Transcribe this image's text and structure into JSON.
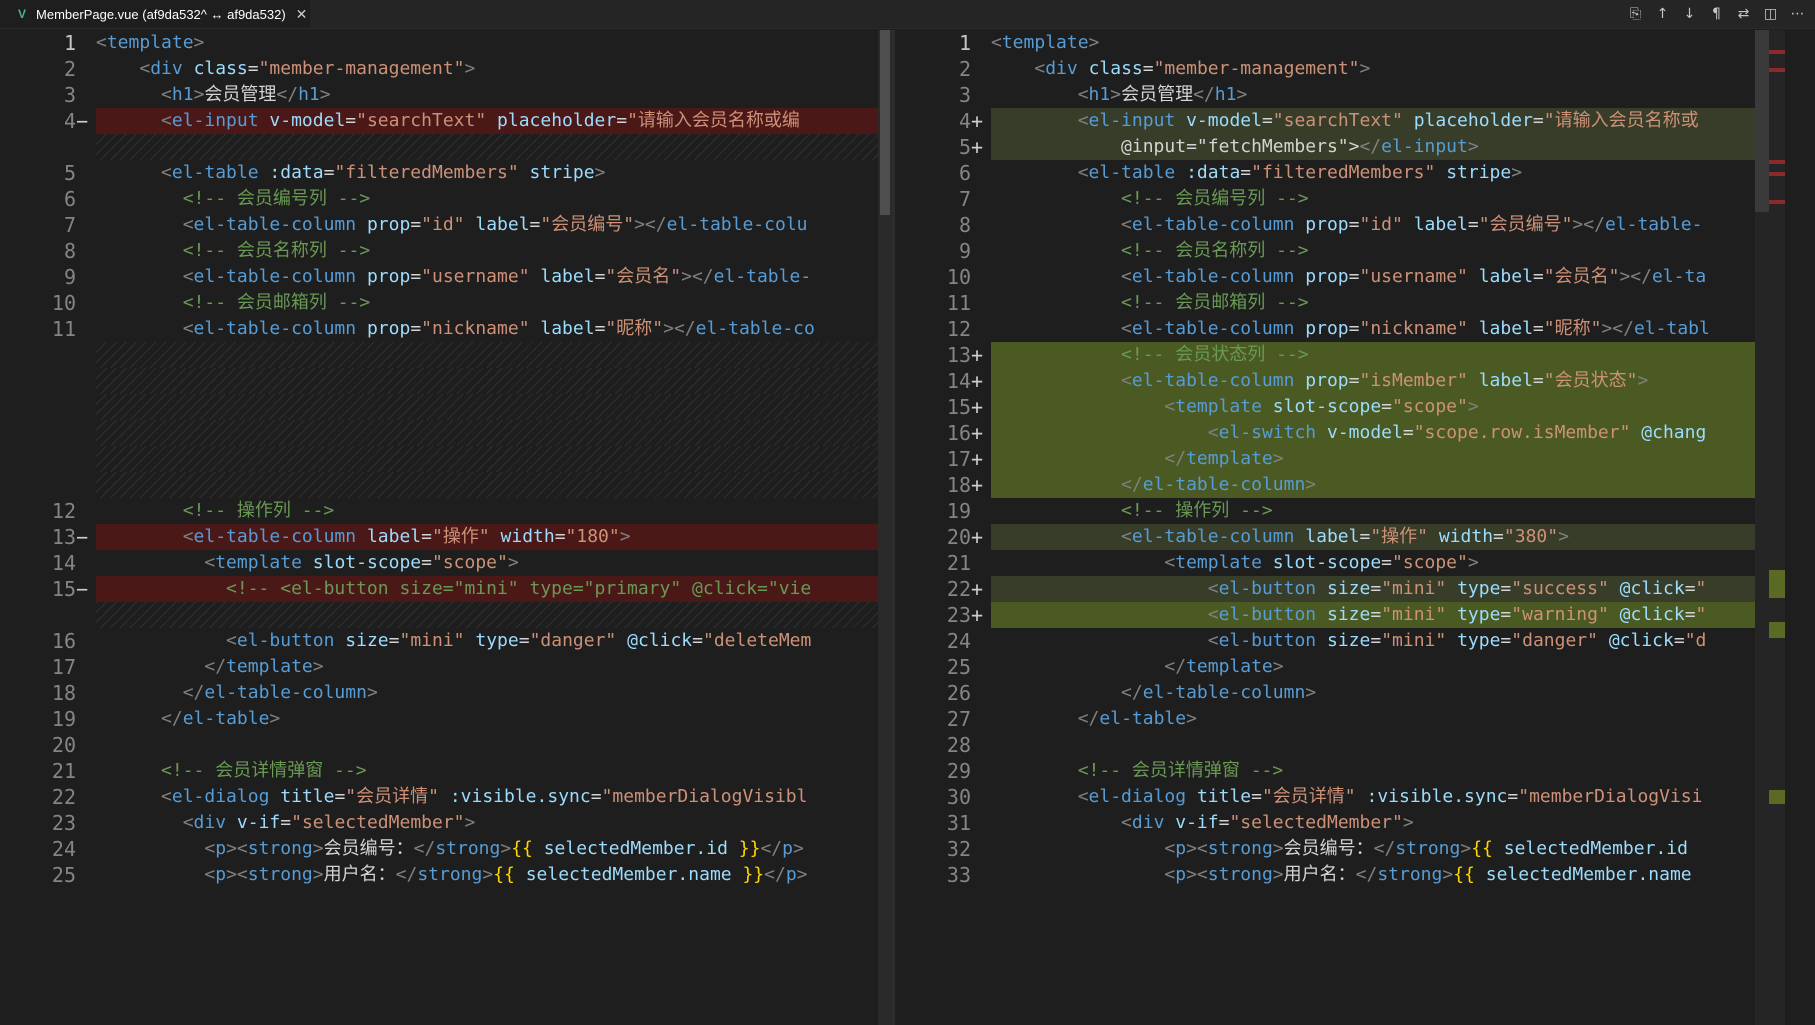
{
  "tab": {
    "title": "MemberPage.vue (af9da532^ ↔ af9da532)",
    "icon": "V",
    "close": "✕"
  },
  "toolbar": {
    "buttons": [
      {
        "name": "open-file-icon",
        "glyph": "⎘"
      },
      {
        "name": "previous-change-icon",
        "glyph": "↑"
      },
      {
        "name": "next-change-icon",
        "glyph": "↓"
      },
      {
        "name": "show-whitespace-icon",
        "glyph": "¶"
      },
      {
        "name": "compare-icon",
        "glyph": "⇄"
      },
      {
        "name": "split-editor-icon",
        "glyph": "◫"
      },
      {
        "name": "more-actions-icon",
        "glyph": "⋯"
      }
    ]
  },
  "colors": {
    "editor_bg": "#1e1e1e",
    "removed_bg": "#4b1818",
    "inserted_bg": "#4b5a22",
    "tag": "#569cd6",
    "attr": "#9cdcfe",
    "string": "#ce9178",
    "comment": "#6a9955"
  },
  "left": {
    "lines": [
      {
        "n": "1",
        "m": "",
        "t": "<template>",
        "kind": ""
      },
      {
        "n": "2",
        "m": "",
        "t": "    <div class=\"member-management\">",
        "kind": ""
      },
      {
        "n": "3",
        "m": "",
        "t": "      <h1>会员管理</h1>",
        "kind": ""
      },
      {
        "n": "4",
        "m": "−",
        "t": "      <el-input v-model=\"searchText\" placeholder=\"请输入会员名称或编",
        "kind": "del"
      },
      {
        "n": "",
        "m": "",
        "t": "",
        "kind": "hatch"
      },
      {
        "n": "5",
        "m": "",
        "t": "      <el-table :data=\"filteredMembers\" stripe>",
        "kind": ""
      },
      {
        "n": "6",
        "m": "",
        "t": "        <!-- 会员编号列 -->",
        "kind": ""
      },
      {
        "n": "7",
        "m": "",
        "t": "        <el-table-column prop=\"id\" label=\"会员编号\"></el-table-colu",
        "kind": ""
      },
      {
        "n": "8",
        "m": "",
        "t": "        <!-- 会员名称列 -->",
        "kind": ""
      },
      {
        "n": "9",
        "m": "",
        "t": "        <el-table-column prop=\"username\" label=\"会员名\"></el-table-",
        "kind": ""
      },
      {
        "n": "10",
        "m": "",
        "t": "        <!-- 会员邮箱列 -->",
        "kind": ""
      },
      {
        "n": "11",
        "m": "",
        "t": "        <el-table-column prop=\"nickname\" label=\"昵称\"></el-table-co",
        "kind": ""
      },
      {
        "n": "",
        "m": "",
        "t": "",
        "kind": "hatch"
      },
      {
        "n": "",
        "m": "",
        "t": "",
        "kind": "hatch"
      },
      {
        "n": "",
        "m": "",
        "t": "",
        "kind": "hatch"
      },
      {
        "n": "",
        "m": "",
        "t": "",
        "kind": "hatch"
      },
      {
        "n": "",
        "m": "",
        "t": "",
        "kind": "hatch"
      },
      {
        "n": "",
        "m": "",
        "t": "",
        "kind": "hatch"
      },
      {
        "n": "12",
        "m": "",
        "t": "        <!-- 操作列 -->",
        "kind": ""
      },
      {
        "n": "13",
        "m": "−",
        "t": "        <el-table-column label=\"操作\" width=\"180\">",
        "kind": "del"
      },
      {
        "n": "14",
        "m": "",
        "t": "          <template slot-scope=\"scope\">",
        "kind": ""
      },
      {
        "n": "15",
        "m": "−",
        "t": "            <!-- <el-button size=\"mini\" type=\"primary\" @click=\"vie",
        "kind": "del"
      },
      {
        "n": "",
        "m": "",
        "t": "",
        "kind": "hatch"
      },
      {
        "n": "16",
        "m": "",
        "t": "            <el-button size=\"mini\" type=\"danger\" @click=\"deleteMem",
        "kind": ""
      },
      {
        "n": "17",
        "m": "",
        "t": "          </template>",
        "kind": ""
      },
      {
        "n": "18",
        "m": "",
        "t": "        </el-table-column>",
        "kind": ""
      },
      {
        "n": "19",
        "m": "",
        "t": "      </el-table>",
        "kind": ""
      },
      {
        "n": "20",
        "m": "",
        "t": "",
        "kind": ""
      },
      {
        "n": "21",
        "m": "",
        "t": "      <!-- 会员详情弹窗 -->",
        "kind": ""
      },
      {
        "n": "22",
        "m": "",
        "t": "      <el-dialog title=\"会员详情\" :visible.sync=\"memberDialogVisibl",
        "kind": ""
      },
      {
        "n": "23",
        "m": "",
        "t": "        <div v-if=\"selectedMember\">",
        "kind": ""
      },
      {
        "n": "24",
        "m": "",
        "t": "          <p><strong>会员编号：</strong>{{ selectedMember.id }}</p>",
        "kind": ""
      },
      {
        "n": "25",
        "m": "",
        "t": "          <p><strong>用户名：</strong>{{ selectedMember.name }}</p>",
        "kind": ""
      }
    ]
  },
  "right": {
    "lines": [
      {
        "n": "1",
        "m": "",
        "t": "<template>",
        "kind": ""
      },
      {
        "n": "2",
        "m": "",
        "t": "    <div class=\"member-management\">",
        "kind": ""
      },
      {
        "n": "3",
        "m": "",
        "t": "        <h1>会员管理</h1>",
        "kind": ""
      },
      {
        "n": "4",
        "m": "+",
        "t": "        <el-input v-model=\"searchText\" placeholder=\"请输入会员名称或",
        "kind": "ins"
      },
      {
        "n": "5",
        "m": "+",
        "t": "            @input=\"fetchMembers\"></el-input>",
        "kind": "ins"
      },
      {
        "n": "6",
        "m": "",
        "t": "        <el-table :data=\"filteredMembers\" stripe>",
        "kind": ""
      },
      {
        "n": "7",
        "m": "",
        "t": "            <!-- 会员编号列 -->",
        "kind": ""
      },
      {
        "n": "8",
        "m": "",
        "t": "            <el-table-column prop=\"id\" label=\"会员编号\"></el-table-",
        "kind": ""
      },
      {
        "n": "9",
        "m": "",
        "t": "            <!-- 会员名称列 -->",
        "kind": ""
      },
      {
        "n": "10",
        "m": "",
        "t": "            <el-table-column prop=\"username\" label=\"会员名\"></el-ta",
        "kind": ""
      },
      {
        "n": "11",
        "m": "",
        "t": "            <!-- 会员邮箱列 -->",
        "kind": ""
      },
      {
        "n": "12",
        "m": "",
        "t": "            <el-table-column prop=\"nickname\" label=\"昵称\"></el-tabl",
        "kind": ""
      },
      {
        "n": "13",
        "m": "+",
        "t": "            <!-- 会员状态列 -->",
        "kind": "insd"
      },
      {
        "n": "14",
        "m": "+",
        "t": "            <el-table-column prop=\"isMember\" label=\"会员状态\">",
        "kind": "insd"
      },
      {
        "n": "15",
        "m": "+",
        "t": "                <template slot-scope=\"scope\">",
        "kind": "insd"
      },
      {
        "n": "16",
        "m": "+",
        "t": "                    <el-switch v-model=\"scope.row.isMember\" @chang",
        "kind": "insd"
      },
      {
        "n": "17",
        "m": "+",
        "t": "                </template>",
        "kind": "insd"
      },
      {
        "n": "18",
        "m": "+",
        "t": "            </el-table-column>",
        "kind": "insd"
      },
      {
        "n": "19",
        "m": "",
        "t": "            <!-- 操作列 -->",
        "kind": ""
      },
      {
        "n": "20",
        "m": "+",
        "t": "            <el-table-column label=\"操作\" width=\"380\">",
        "kind": "ins"
      },
      {
        "n": "21",
        "m": "",
        "t": "                <template slot-scope=\"scope\">",
        "kind": ""
      },
      {
        "n": "22",
        "m": "+",
        "t": "                    <el-button size=\"mini\" type=\"success\" @click=\"",
        "kind": "ins"
      },
      {
        "n": "23",
        "m": "+",
        "t": "                    <el-button size=\"mini\" type=\"warning\" @click=\"",
        "kind": "insd"
      },
      {
        "n": "24",
        "m": "",
        "t": "                    <el-button size=\"mini\" type=\"danger\" @click=\"d",
        "kind": ""
      },
      {
        "n": "25",
        "m": "",
        "t": "                </template>",
        "kind": ""
      },
      {
        "n": "26",
        "m": "",
        "t": "            </el-table-column>",
        "kind": ""
      },
      {
        "n": "27",
        "m": "",
        "t": "        </el-table>",
        "kind": ""
      },
      {
        "n": "28",
        "m": "",
        "t": "",
        "kind": ""
      },
      {
        "n": "29",
        "m": "",
        "t": "        <!-- 会员详情弹窗 -->",
        "kind": ""
      },
      {
        "n": "30",
        "m": "",
        "t": "        <el-dialog title=\"会员详情\" :visible.sync=\"memberDialogVisi",
        "kind": ""
      },
      {
        "n": "31",
        "m": "",
        "t": "            <div v-if=\"selectedMember\">",
        "kind": ""
      },
      {
        "n": "32",
        "m": "",
        "t": "                <p><strong>会员编号：</strong>{{ selectedMember.id",
        "kind": ""
      },
      {
        "n": "33",
        "m": "",
        "t": "                <p><strong>用户名：</strong>{{ selectedMember.name",
        "kind": ""
      }
    ]
  }
}
